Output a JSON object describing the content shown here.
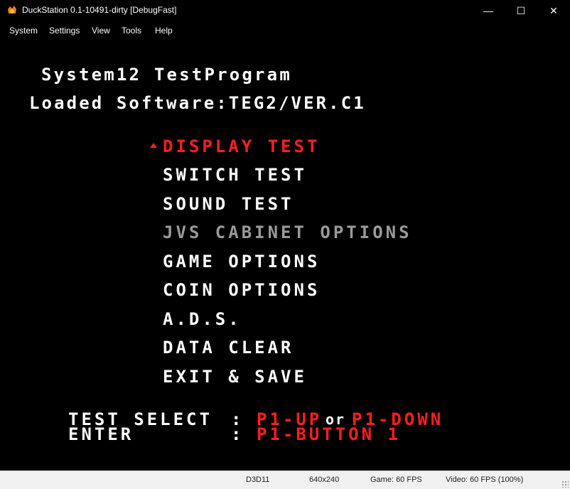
{
  "window": {
    "title": "DuckStation 0.1-10491-dirty [DebugFast]",
    "controls": {
      "minimize": "—",
      "maximize": "☐",
      "close": "✕"
    }
  },
  "menu": [
    "System",
    "Settings",
    "View",
    "Tools",
    "Help"
  ],
  "game": {
    "header1": "System12 TestProgram",
    "header2": "Loaded Software:TEG2/VER.C1",
    "items": [
      "DISPLAY TEST",
      "SWITCH TEST",
      "SOUND TEST",
      "JVS CABINET OPTIONS",
      "GAME OPTIONS",
      "COIN OPTIONS",
      "A.D.S.",
      "DATA CLEAR",
      "EXIT & SAVE"
    ],
    "selected_item": "DISPLAY TEST",
    "disabled_item": "JVS CABINET OPTIONS",
    "help": {
      "select_label": "TEST SELECT",
      "enter_label": "ENTER",
      "colon": ":",
      "up": "P1-UP",
      "or": "or",
      "down": "P1-DOWN",
      "button": "P1-BUTTON 1"
    },
    "colors": {
      "highlight": "#ff1e1e",
      "disabled": "#9a9a9a",
      "normal": "#ffffff"
    }
  },
  "status": {
    "renderer": "D3D11",
    "resolution": "640x240",
    "game_fps": "Game: 60 FPS",
    "video_fps": "Video: 60 FPS (100%)"
  }
}
